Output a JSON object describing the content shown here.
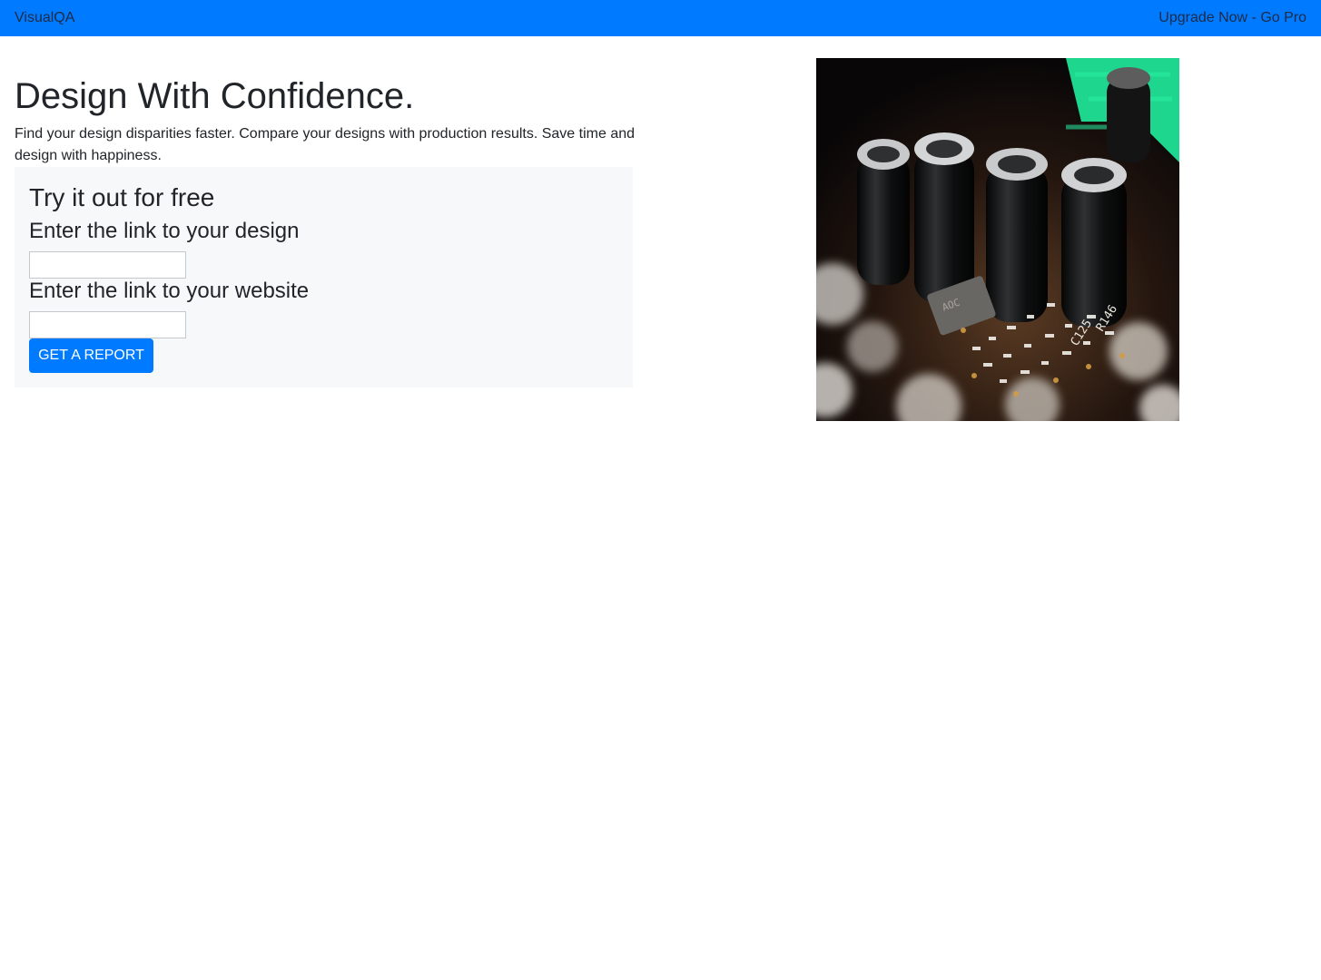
{
  "navbar": {
    "brand": "VisualQA",
    "upgrade_link": "Upgrade Now - Go Pro"
  },
  "hero": {
    "title": "Design With Confidence.",
    "description": "Find your design disparities faster. Compare your designs with production results. Save time and design with happiness."
  },
  "trial_form": {
    "heading": "Try it out for free",
    "design_label": "Enter the link to your design",
    "design_value": "",
    "website_label": "Enter the link to your website",
    "website_value": "",
    "submit_label": "GET A REPORT"
  },
  "colors": {
    "primary": "#007bff",
    "panel_background": "#f7f8f9",
    "text": "#212529"
  },
  "hero_image": {
    "description_icon": "circuit-board-photo"
  }
}
